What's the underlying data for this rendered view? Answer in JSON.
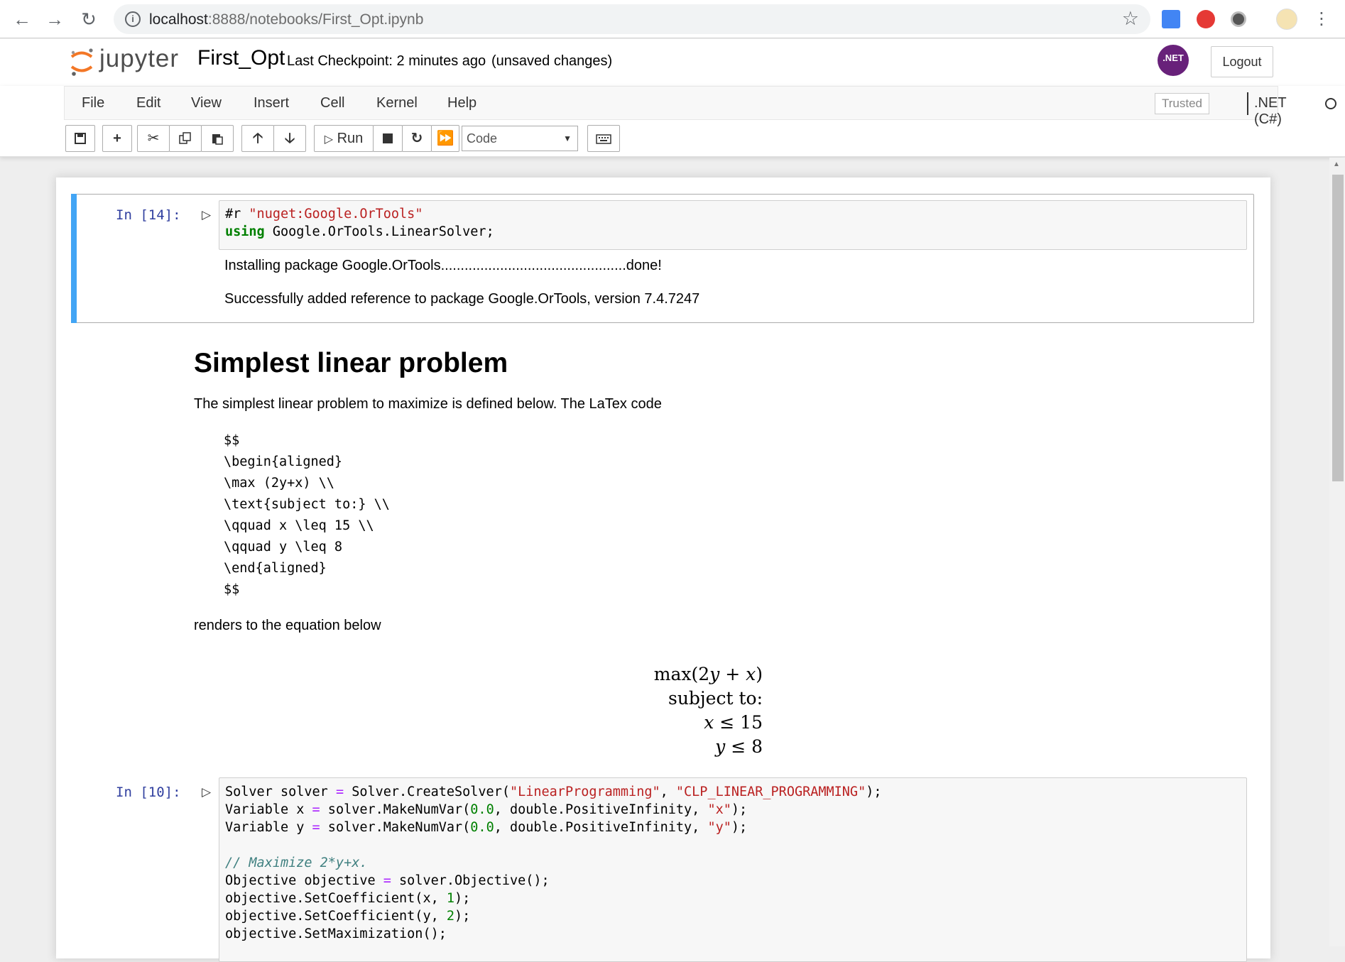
{
  "browser": {
    "url_host": "localhost",
    "url_rest": ":8888/notebooks/First_Opt.ipynb"
  },
  "header": {
    "logo_text": "jupyter",
    "notebook_name": "First_Opt",
    "checkpoint": "Last Checkpoint: 2 minutes ago",
    "unsaved": "(unsaved changes)",
    "net_logo": ".NET",
    "logout": "Logout"
  },
  "menubar": {
    "items": [
      "File",
      "Edit",
      "View",
      "Insert",
      "Cell",
      "Kernel",
      "Help"
    ],
    "trusted": "Trusted",
    "kernel": ".NET (C#)"
  },
  "toolbar": {
    "run_label": "Run",
    "cell_type": "Code"
  },
  "cells": {
    "c1": {
      "prompt": "In [14]:",
      "line1_a": "#r ",
      "line1_b": "\"nuget:Google.OrTools\"",
      "line2_a": "using",
      "line2_b": " Google.OrTools.LinearSolver;",
      "out1": "Installing package Google.OrTools...............................................done!",
      "out2": "Successfully added reference to package Google.OrTools, version 7.4.7247"
    },
    "md": {
      "heading": "Simplest linear problem",
      "para1": "The simplest linear problem to maximize is defined below. The LaTex code",
      "latex": [
        "$$",
        "\\begin{aligned}",
        "\\max (2y+x) \\\\",
        "\\text{subject to:} \\\\",
        "\\qquad x \\leq 15 \\\\",
        "\\qquad y \\leq 8",
        "\\end{aligned}",
        "$$"
      ],
      "para2": "renders to the equation below",
      "eq1_a": "max(2",
      "eq1_b": "y",
      "eq1_c": " + ",
      "eq1_d": "x",
      "eq1_e": ")",
      "eq2": "subject to:",
      "eq3_a": "x",
      "eq3_b": " ≤ 15",
      "eq4_a": "y",
      "eq4_b": " ≤ 8"
    },
    "c2": {
      "prompt": "In [10]:",
      "comment": "// Maximize 2*y+x."
    }
  }
}
